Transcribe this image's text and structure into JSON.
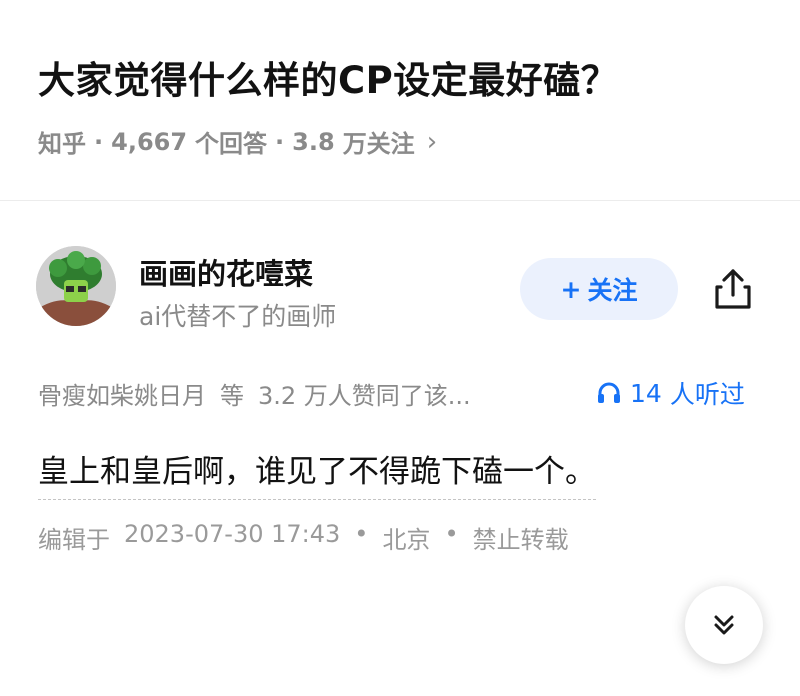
{
  "question": {
    "title": "大家觉得什么样的CP设定最好磕？",
    "source": "知乎",
    "answer_count": "4,667",
    "answer_unit": "个回答",
    "follow_count": "3.8",
    "follow_unit": "万关注",
    "chevron": "›",
    "separator": "·"
  },
  "author": {
    "name": "画画的花噎菜",
    "bio": "ai代替不了的画师",
    "follow_label": "关注",
    "follow_plus": "+",
    "avatar_icon": "avatar-icon",
    "share_icon": "share-icon"
  },
  "answer": {
    "upvoters": "骨瘦如柴姚日月",
    "upvote_word": "等",
    "upvote_count_text": "3.2 万人赞同了该...",
    "listen_count": "14",
    "listen_label": "人听过",
    "listen_icon": "headphones-icon",
    "text": "皇上和皇后啊，谁见了不得跪下磕一个。",
    "edit_prefix": "编辑于",
    "edit_time": "2023-07-30  17:43",
    "location": "北京",
    "copyright": "禁止转载",
    "dot": "•"
  },
  "colors": {
    "accent": "#1772f6",
    "follow_bg": "#ebf1fd",
    "muted": "#8a8a8a"
  }
}
